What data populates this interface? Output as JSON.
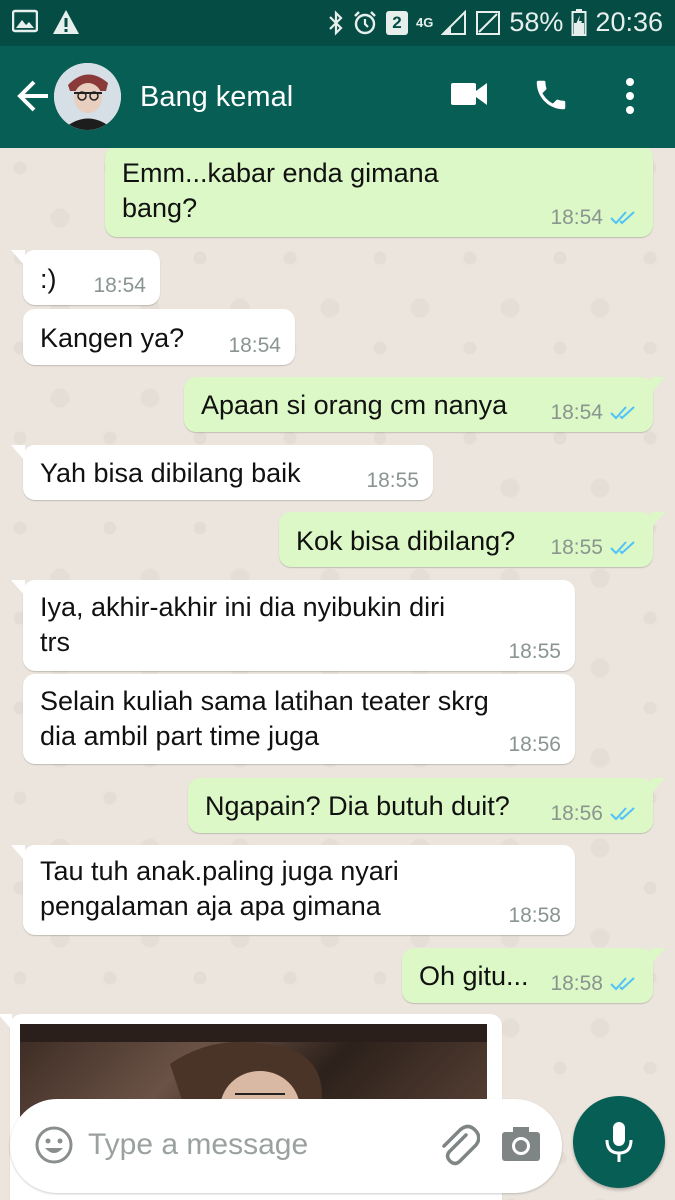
{
  "status_bar": {
    "network": "4G",
    "notification_count": "2",
    "battery": "58%",
    "time": "20:36"
  },
  "header": {
    "contact_name": "Bang kemal"
  },
  "messages": [
    {
      "dir": "out",
      "text": [
        "Emm...kabar enda gimana",
        "bang?"
      ],
      "time": "18:54",
      "ticks": "read"
    },
    {
      "dir": "in",
      "text": [
        ":)"
      ],
      "time": "18:54"
    },
    {
      "dir": "in",
      "text": [
        "Kangen ya?"
      ],
      "time": "18:54"
    },
    {
      "dir": "out",
      "text": [
        "Apaan si orang cm nanya"
      ],
      "time": "18:54",
      "ticks": "read"
    },
    {
      "dir": "in",
      "text": [
        "Yah bisa dibilang baik"
      ],
      "time": "18:55"
    },
    {
      "dir": "out",
      "text": [
        "Kok bisa dibilang?"
      ],
      "time": "18:55",
      "ticks": "read"
    },
    {
      "dir": "in",
      "text": [
        "Iya, akhir-akhir ini dia nyibukin diri",
        "trs"
      ],
      "time": "18:55"
    },
    {
      "dir": "in",
      "text": [
        "Selain kuliah sama latihan teater skrg",
        "dia ambil part time juga"
      ],
      "time": "18:56"
    },
    {
      "dir": "out",
      "text": [
        "Ngapain? Dia butuh duit?"
      ],
      "time": "18:56",
      "ticks": "read"
    },
    {
      "dir": "in",
      "text": [
        "Tau tuh anak.paling juga nyari",
        "pengalaman aja apa gimana"
      ],
      "time": "18:58"
    },
    {
      "dir": "out",
      "text": [
        "Oh gitu..."
      ],
      "time": "18:58",
      "ticks": "read"
    }
  ],
  "input": {
    "placeholder": "Type a message"
  },
  "colors": {
    "header": "#075E54",
    "status_bar": "#054D44",
    "outgoing_bubble": "#DCF8C6",
    "incoming_bubble": "#FFFFFF",
    "read_ticks": "#4FC3F7",
    "chat_background": "#ECE5DD"
  },
  "icons": [
    "image-icon",
    "warning-icon",
    "bluetooth-icon",
    "alarm-icon",
    "signal-icon",
    "battery-icon",
    "back-arrow-icon",
    "video-call-icon",
    "phone-icon",
    "more-vert-icon",
    "emoji-icon",
    "attach-icon",
    "camera-icon",
    "mic-icon",
    "double-check-icon"
  ]
}
